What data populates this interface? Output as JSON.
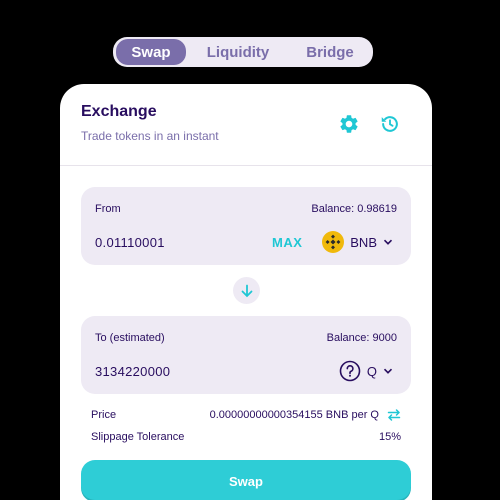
{
  "tabs": {
    "swap": "Swap",
    "liquidity": "Liquidity",
    "bridge": "Bridge",
    "active": "Swap"
  },
  "header": {
    "title": "Exchange",
    "subtitle": "Trade tokens in an instant",
    "settings_icon": "gear-icon",
    "history_icon": "history-icon"
  },
  "from": {
    "label": "From",
    "balance": "Balance: 0.98619",
    "value": "0.01110001",
    "max": "MAX",
    "token": "BNB"
  },
  "to": {
    "label": "To (estimated)",
    "balance": "Balance: 9000",
    "value": "3134220000",
    "token": "Q"
  },
  "info": {
    "price_label": "Price",
    "price_value": "0.00000000000354155 BNB per Q",
    "slippage_label": "Slippage Tolerance",
    "slippage_value": "15%"
  },
  "swap_button": "Swap",
  "colors": {
    "primary": "#1fc7d4",
    "text": "#280d5f",
    "secondary": "#7a6eaa",
    "input_bg": "#eeeaf4",
    "bnb": "#f0b90b"
  }
}
